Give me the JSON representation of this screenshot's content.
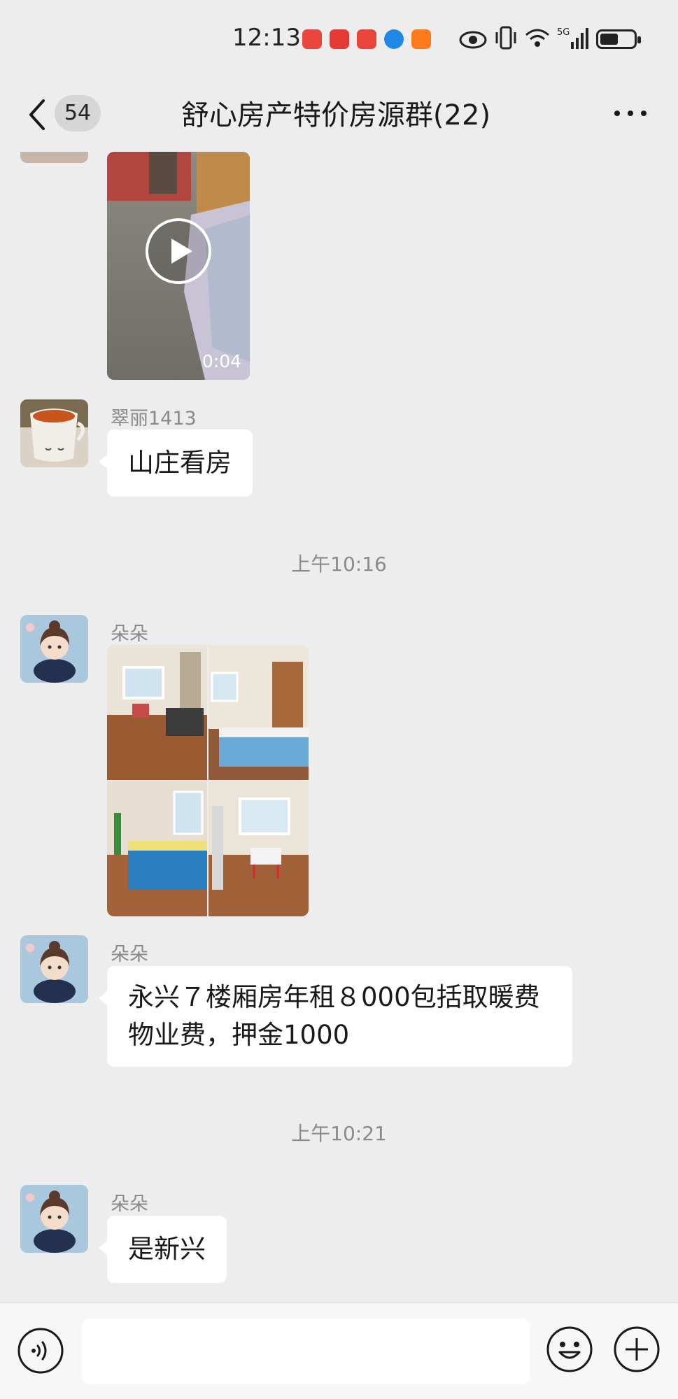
{
  "status_bar": {
    "time": "12:13",
    "battery_level": 0.55,
    "network": "5G",
    "notification_icons": [
      "huawei-app-icon",
      "red-app-icon",
      "huawei-app-icon",
      "browser-icon",
      "orange-app-icon"
    ],
    "status_icons": [
      "eye-icon",
      "vibrate-icon",
      "wifi-icon",
      "signal-icon",
      "battery-icon"
    ]
  },
  "nav": {
    "unread_count": "54",
    "title": "舒心房产特价房源群(22)"
  },
  "messages": {
    "video": {
      "duration": "0:04"
    },
    "m1": {
      "sender": "翠丽1413",
      "text": "山庄看房"
    },
    "t1": "上午10:16",
    "m2": {
      "sender": "朵朵"
    },
    "m3": {
      "sender": "朵朵",
      "line1": "永兴７楼厢房年租８000包括取暖费",
      "line2": "物业费，押金1000"
    },
    "t2": "上午10:21",
    "m4": {
      "sender": "朵朵",
      "text": "是新兴"
    }
  },
  "input": {
    "value": "",
    "placeholder": ""
  },
  "colors": {
    "background": "#ededed",
    "bubble": "#ffffff",
    "time_text": "#8a8a8a"
  }
}
